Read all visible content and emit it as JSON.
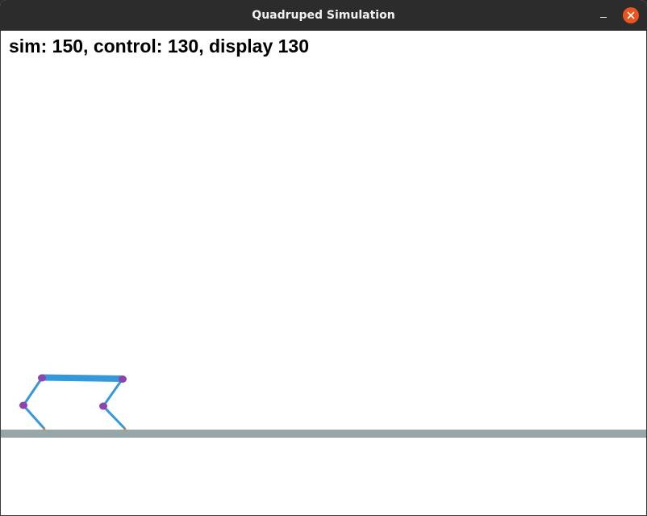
{
  "window": {
    "title": "Quadruped Simulation",
    "controls": {
      "minimize_icon": "minimize-icon",
      "close_icon": "close-icon",
      "close_color": "#e95420"
    }
  },
  "status": {
    "readout": "sim: 150, control: 130, display 130"
  },
  "scene": {
    "colors": {
      "ground": "#97a6a7",
      "leg": "#3498db",
      "body": "#3498db",
      "joint": "#8e44ad",
      "foot": "#e67e22",
      "background": "#ffffff"
    }
  }
}
